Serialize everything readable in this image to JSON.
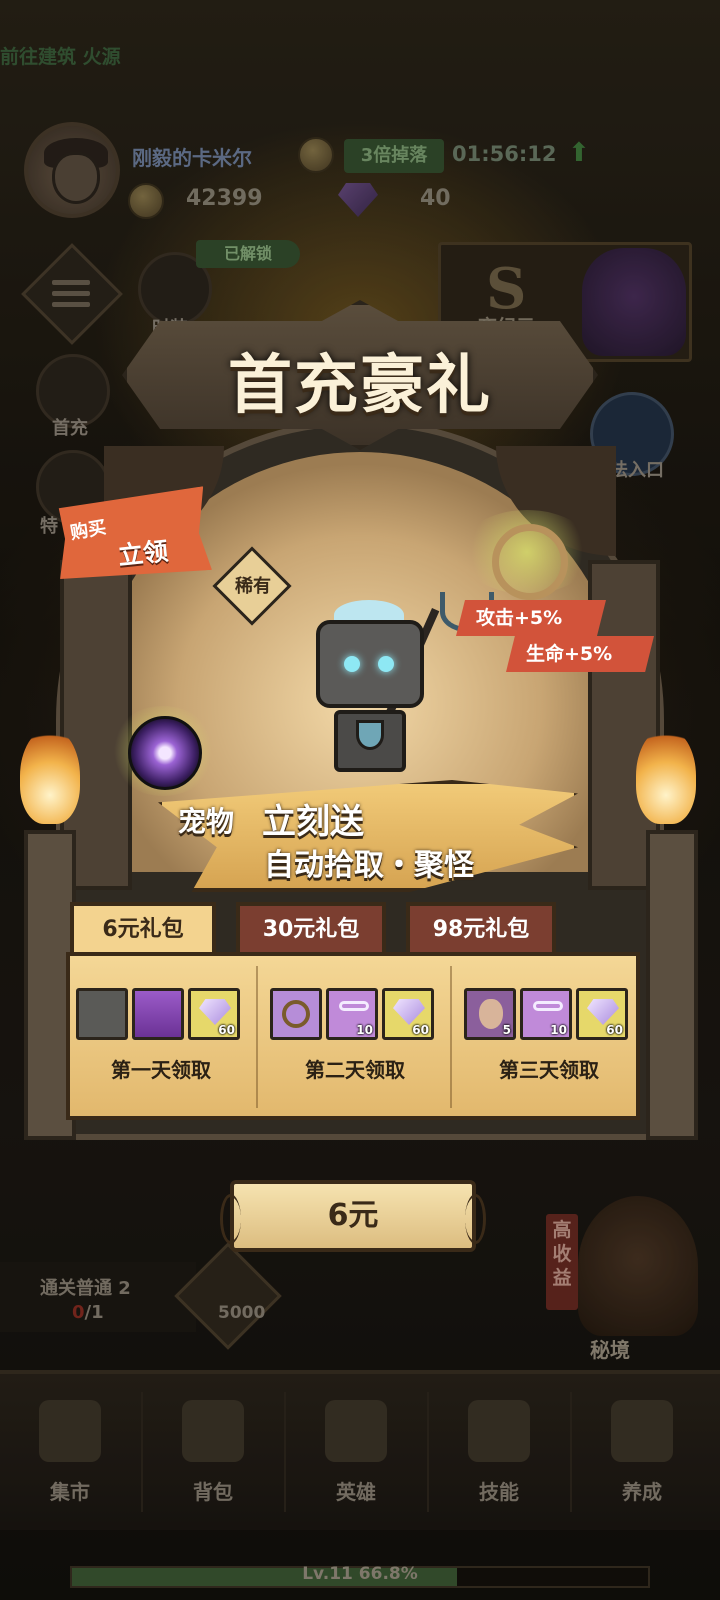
{
  "hud": {
    "quest_text": "前往建筑 火源",
    "player_name": "刚毅的卡米尔",
    "coins": "42399",
    "gems": "40",
    "drop_bonus": "3倍掉落",
    "timer": "01:56:12",
    "unlocked_tag": "已解锁",
    "fashion_label": "时装",
    "first_charge_label": "首充",
    "special_label": "特",
    "event_label": "夜纪元",
    "play_entrance_label": "玩法入口"
  },
  "popup": {
    "title": "首充豪礼",
    "buy_tag_line1": "购买",
    "buy_tag_line2": "立领",
    "rarity": "稀有",
    "stat_attack": "攻击+5%",
    "stat_hp": "生命+5%",
    "pet_line1a": "宠物",
    "pet_line1b": "立刻送",
    "pet_line2": "自动拾取・聚怪",
    "tabs": [
      "6元礼包",
      "30元礼包",
      "98元礼包"
    ],
    "selected_tab": 0,
    "days": [
      {
        "label": "第一天领取",
        "items": [
          {
            "icon": "pet-icon",
            "count": ""
          },
          {
            "icon": "skill-book-icon",
            "count": ""
          },
          {
            "icon": "diamond-icon",
            "count": "60"
          }
        ]
      },
      {
        "label": "第二天领取",
        "items": [
          {
            "icon": "ring-icon",
            "count": ""
          },
          {
            "icon": "key-icon",
            "count": "10"
          },
          {
            "icon": "diamond-icon",
            "count": "60"
          }
        ]
      },
      {
        "label": "第三天领取",
        "items": [
          {
            "icon": "mask-icon",
            "count": "5"
          },
          {
            "icon": "key-icon",
            "count": "10"
          },
          {
            "icon": "diamond-icon",
            "count": "60"
          }
        ]
      }
    ],
    "price": "6元"
  },
  "quest": {
    "title": "通关普通 2",
    "progress_current": "0",
    "progress_total": "/1",
    "reward": "5000"
  },
  "secret_realm": {
    "badge": "高收益",
    "label": "秘境"
  },
  "bottom_nav": [
    "集市",
    "背包",
    "英雄",
    "技能",
    "养成"
  ],
  "level": {
    "text": "Lv.11  66.8%",
    "progress": 0.668
  },
  "colors": {
    "accent_orange": "#e0673c",
    "tab_selected": "#f3d38f",
    "tab_inactive": "#7b3e30",
    "stat_red": "#d2533a"
  }
}
